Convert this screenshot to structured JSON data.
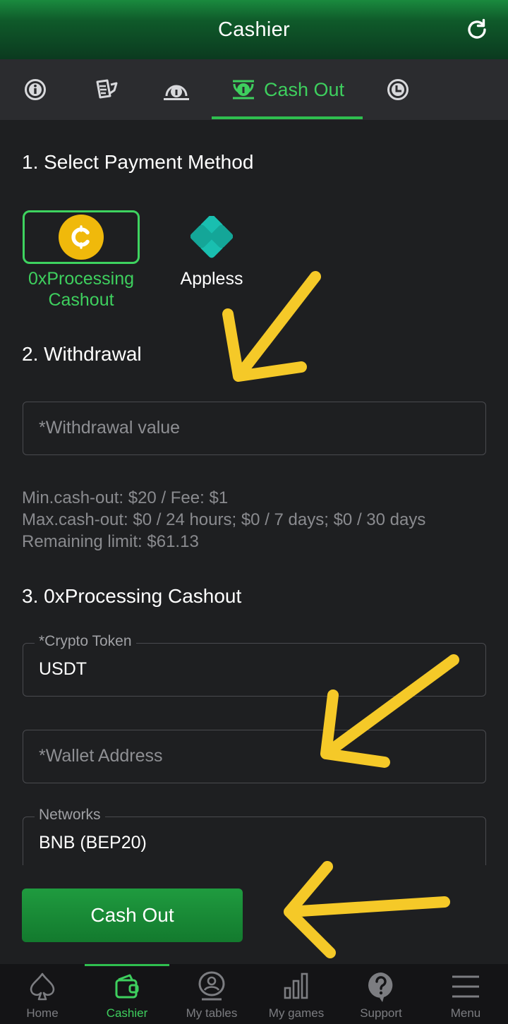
{
  "header": {
    "title": "Cashier",
    "refresh_icon": "refresh-icon"
  },
  "tabs": [
    {
      "icon": "info-icon",
      "label": ""
    },
    {
      "icon": "receipt-icon",
      "label": ""
    },
    {
      "icon": "deposit-icon",
      "label": ""
    },
    {
      "icon": "cash-out-icon",
      "label": "Cash Out",
      "active": true
    },
    {
      "icon": "history-icon",
      "label": ""
    }
  ],
  "section1": {
    "title": "1. Select Payment Method",
    "methods": [
      {
        "label_line1": "0xProcessing",
        "label_line2": "Cashout",
        "icon": "coin-icon",
        "selected": true
      },
      {
        "label_line1": "Appless",
        "label_line2": "",
        "icon": "appless-icon",
        "selected": false
      }
    ]
  },
  "section2": {
    "title": "2. Withdrawal",
    "withdrawal_placeholder": "*Withdrawal value",
    "limits": {
      "line1": "Min.cash-out: $20 / Fee: $1",
      "line2": "Max.cash-out: $0 / 24 hours; $0 / 7 days; $0 / 30 days",
      "line3": "Remaining limit: $61.13"
    }
  },
  "section3": {
    "title": "3. 0xProcessing Cashout",
    "crypto_token_label": "*Crypto Token",
    "crypto_token_value": "USDT",
    "wallet_placeholder": "*Wallet Address",
    "networks_label": "Networks",
    "networks_value": "BNB (BEP20)"
  },
  "cashout_button": "Cash Out",
  "colors": {
    "accent": "#3ecf5e",
    "annotation_arrow": "#f5c928",
    "background": "#1e1f21"
  },
  "bottom_nav": [
    {
      "label": "Home",
      "icon": "spade-icon"
    },
    {
      "label": "Cashier",
      "icon": "wallet-icon",
      "active": true
    },
    {
      "label": "My tables",
      "icon": "tables-icon"
    },
    {
      "label": "My games",
      "icon": "chart-icon"
    },
    {
      "label": "Support",
      "icon": "help-icon"
    },
    {
      "label": "Menu",
      "icon": "menu-icon"
    }
  ]
}
